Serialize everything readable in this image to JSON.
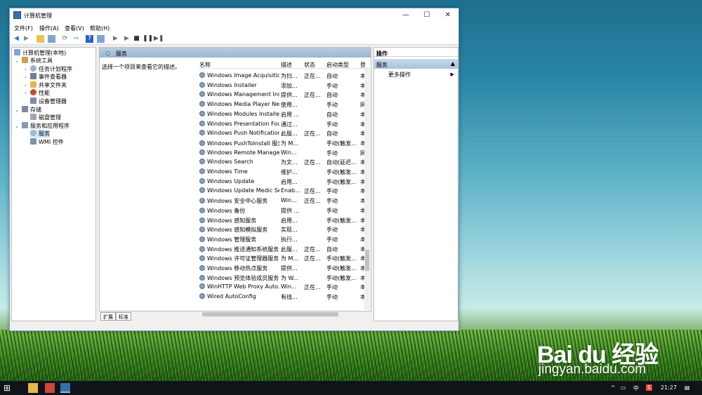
{
  "window": {
    "title": "计算机管理",
    "menu": [
      "文件(F)",
      "操作(A)",
      "查看(V)",
      "帮助(H)"
    ]
  },
  "tree": {
    "root": "计算机管理(本地)",
    "items": [
      {
        "label": "系统工具",
        "level": 1
      },
      {
        "label": "任务计划程序",
        "level": 2
      },
      {
        "label": "事件查看器",
        "level": 2
      },
      {
        "label": "共享文件夹",
        "level": 2
      },
      {
        "label": "性能",
        "level": 2
      },
      {
        "label": "设备管理器",
        "level": 2
      },
      {
        "label": "存储",
        "level": 1
      },
      {
        "label": "磁盘管理",
        "level": 2
      },
      {
        "label": "服务和应用程序",
        "level": 1
      },
      {
        "label": "服务",
        "level": 2
      },
      {
        "label": "WMI 控件",
        "level": 2
      }
    ]
  },
  "center": {
    "header": "服务",
    "desc": "选择一个项目来查看它的描述。",
    "columns": [
      "名称",
      "描述",
      "状态",
      "启动类型",
      "登"
    ],
    "rows": [
      [
        "Windows Image Acquisitio...",
        "为扫...",
        "正在...",
        "自动",
        "本"
      ],
      [
        "Windows Installer",
        "添加...",
        "",
        "手动",
        "本"
      ],
      [
        "Windows Management Ins...",
        "提供...",
        "正在...",
        "自动",
        "本"
      ],
      [
        "Windows Media Player Net...",
        "使用...",
        "",
        "手动",
        "网"
      ],
      [
        "Windows Modules Installer",
        "启用 ...",
        "",
        "自动",
        "本"
      ],
      [
        "Windows Presentation Fou...",
        "通过...",
        "",
        "手动",
        "本"
      ],
      [
        "Windows Push Notification...",
        "此服...",
        "正在...",
        "自动",
        "本"
      ],
      [
        "Windows PushToInstall 服务",
        "为 M...",
        "",
        "手动(触发...",
        "本"
      ],
      [
        "Windows Remote Manage...",
        "Win...",
        "",
        "手动",
        "网"
      ],
      [
        "Windows Search",
        "为文...",
        "正在...",
        "自动(延迟...",
        "本"
      ],
      [
        "Windows Time",
        "维护...",
        "",
        "手动(触发...",
        "本"
      ],
      [
        "Windows Update",
        "启用...",
        "",
        "手动(触发...",
        "本"
      ],
      [
        "Windows Update Medic Se...",
        "Enab...",
        "正在...",
        "手动",
        "本"
      ],
      [
        "Windows 安全中心服务",
        "Win...",
        "正在...",
        "手动",
        "本"
      ],
      [
        "Windows 备份",
        "提供 ...",
        "",
        "手动",
        "本"
      ],
      [
        "Windows 感知服务",
        "启用...",
        "",
        "手动(触发...",
        "本"
      ],
      [
        "Windows 感知模拟服务",
        "实现...",
        "",
        "手动",
        "本"
      ],
      [
        "Windows 管理服务",
        "执行...",
        "",
        "手动",
        "本"
      ],
      [
        "Windows 推送通知系统服务",
        "此服...",
        "正在...",
        "自动",
        "本"
      ],
      [
        "Windows 许可证管理器服务",
        "为 M...",
        "正在...",
        "手动(触发...",
        "本"
      ],
      [
        "Windows 移动热点服务",
        "提供...",
        "",
        "手动(触发...",
        "本"
      ],
      [
        "Windows 预览体验成员服务",
        "为 W...",
        "",
        "手动(触发...",
        "本"
      ],
      [
        "WinHTTP Web Proxy Auto...",
        "Win...",
        "正在...",
        "手动",
        "本"
      ],
      [
        "Wired AutoConfig",
        "有线...",
        "",
        "手动",
        "本"
      ]
    ],
    "tabs": [
      "扩展",
      "标准"
    ]
  },
  "actions": {
    "header": "操作",
    "section": "服务",
    "more": "更多操作"
  },
  "taskbar": {
    "ime": "中",
    "sogou": "S",
    "time": "21:27"
  },
  "watermark": {
    "logo": "Bai du 经验",
    "url": "jingyan.baidu.com"
  }
}
